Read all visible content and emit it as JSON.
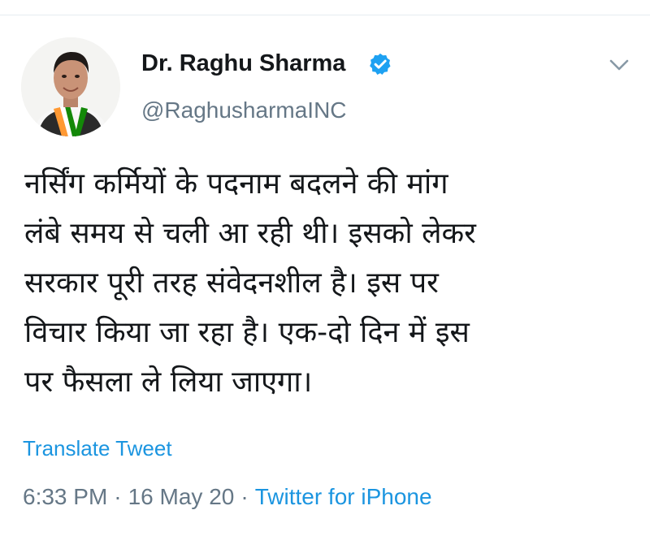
{
  "tweet": {
    "author": {
      "display_name": "Dr. Raghu Sharma",
      "handle": "@RaghusharmaINC",
      "verified": true,
      "verified_badge_icon": "verified-badge-icon",
      "avatar_icon": "profile-photo"
    },
    "menu_icon": "chevron-down-icon",
    "text_lines": [
      "नर्सिंग कर्मियों के पदनाम बदलने की मांग",
      "लंबे समय से चली आ रही थी। इसको लेकर",
      "सरकार पूरी तरह संवेदनशील है। इस पर",
      "विचार किया जा रहा है। एक-दो दिन में इस",
      "पर फैसला ले लिया जाएगा।"
    ],
    "translate_label": "Translate Tweet",
    "time": "6:33 PM",
    "date": "16 May 20",
    "separator": "·",
    "source": "Twitter for iPhone"
  },
  "colors": {
    "link_blue": "#1b95e0",
    "secondary_gray": "#657786",
    "text_dark": "#14171a",
    "verified_blue": "#1da1f2",
    "divider": "#e6ecf0"
  }
}
